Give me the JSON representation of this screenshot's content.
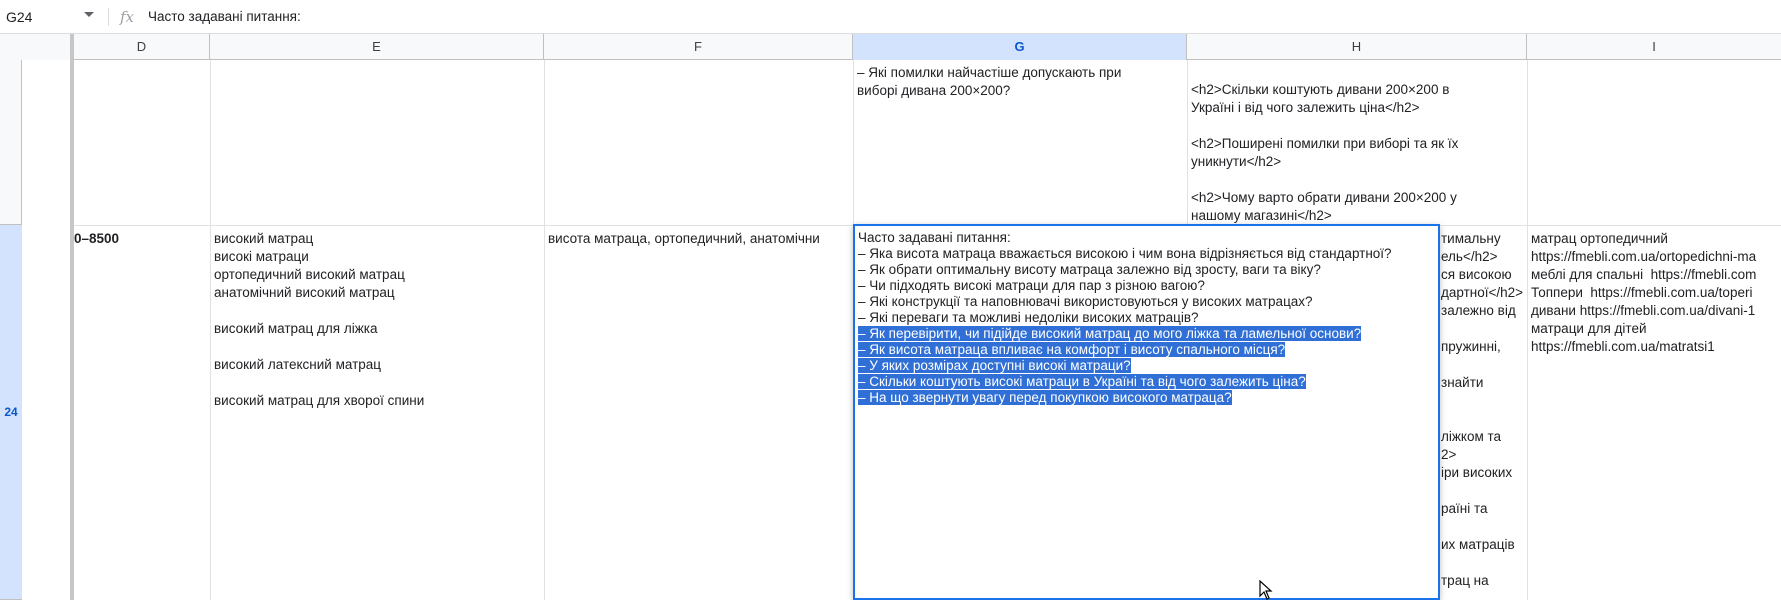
{
  "formula_bar": {
    "name_box": "G24",
    "fx": "fx",
    "content": "Часто задавані питання:"
  },
  "columns": [
    "D",
    "E",
    "F",
    "G",
    "H",
    "I"
  ],
  "rows": {
    "row_top_number": "",
    "row_24_number": "24"
  },
  "cells": {
    "g_top": "– Які помилки найчастіше допускають при\nвиборі дивана 200×200?",
    "h_top": "<h2>Скільки коштують дивани 200×200 в\nУкраїні і від чого залежить ціна</h2>\n\n<h2>Поширені помилки при виборі та як їх\nуникнути</h2>\n\n<h2>Чому варто обрати дивани 200×200 у\nнашому магазині</h2>",
    "d24": "0–8500",
    "e24": "високий матрац\nвисокі матраци\nортопедичний високий матрац\nанатомічний високий матрац\n\nвисокий матрац для ліжка\n\nвисокий латексний матрац\n\nвисокий матрац для хворої спини",
    "f24": "висота матраца, ортопедичний, анатомічни",
    "h24": "тимальну\nель</h2>\nся високою\nдартної</h2>\nзалежно від\n\nпружинні,\n\nзнайти\n\n\nліжком та\n2>\nіри високих\n\nраїні та\n\nих матраців\n\nтрац на",
    "i24": "матрац ортопедичний\nhttps://fmebli.com.ua/ortopedichni-ma\nмеблі для спальні  https://fmebli.com\nТоппери  https://fmebli.com.ua/toperi\nдивани https://fmebli.com.ua/divani-1\nматраци для дітей\nhttps://fmebli.com.ua/matratsi1"
  },
  "editor": {
    "lines": [
      {
        "text": "Часто задавані питання:",
        "selected": false
      },
      {
        "text": "– Яка висота матраца вважається високою і чим вона відрізняється від стандартної?",
        "selected": false
      },
      {
        "text": "– Як обрати оптимальну висоту матраца залежно від зросту, ваги та віку?",
        "selected": false
      },
      {
        "text": "– Чи підходять високі матраци для пар з різною вагою?",
        "selected": false
      },
      {
        "text": "– Які конструкції та наповнювачі використовуються у високих матрацах?",
        "selected": false
      },
      {
        "text": "– Які переваги та можливі недоліки високих матраців?",
        "selected": false
      },
      {
        "text": "– Як перевірити, чи підійде високий матрац до мого ліжка та ламельної основи?",
        "selected": true
      },
      {
        "text": "– Як висота матраца впливає на комфорт і висоту спального місця?",
        "selected": true
      },
      {
        "text": "– У яких розмірах доступні високі матраци?",
        "selected": true
      },
      {
        "text": "– Скільки коштують високі матраци в Україні та від чого залежить ціна?",
        "selected": true
      },
      {
        "text": "– На що звернути увагу перед покупкою високого матраца?",
        "selected": true
      }
    ]
  },
  "icons": {
    "dropdown": "chevron-down-icon",
    "fx": "function-icon",
    "cursor": "mouse-pointer-icon"
  },
  "colors": {
    "selection_highlight": "#2f6fd6",
    "active_border": "#1a73e8",
    "header_selected": "#d3e3fd"
  }
}
